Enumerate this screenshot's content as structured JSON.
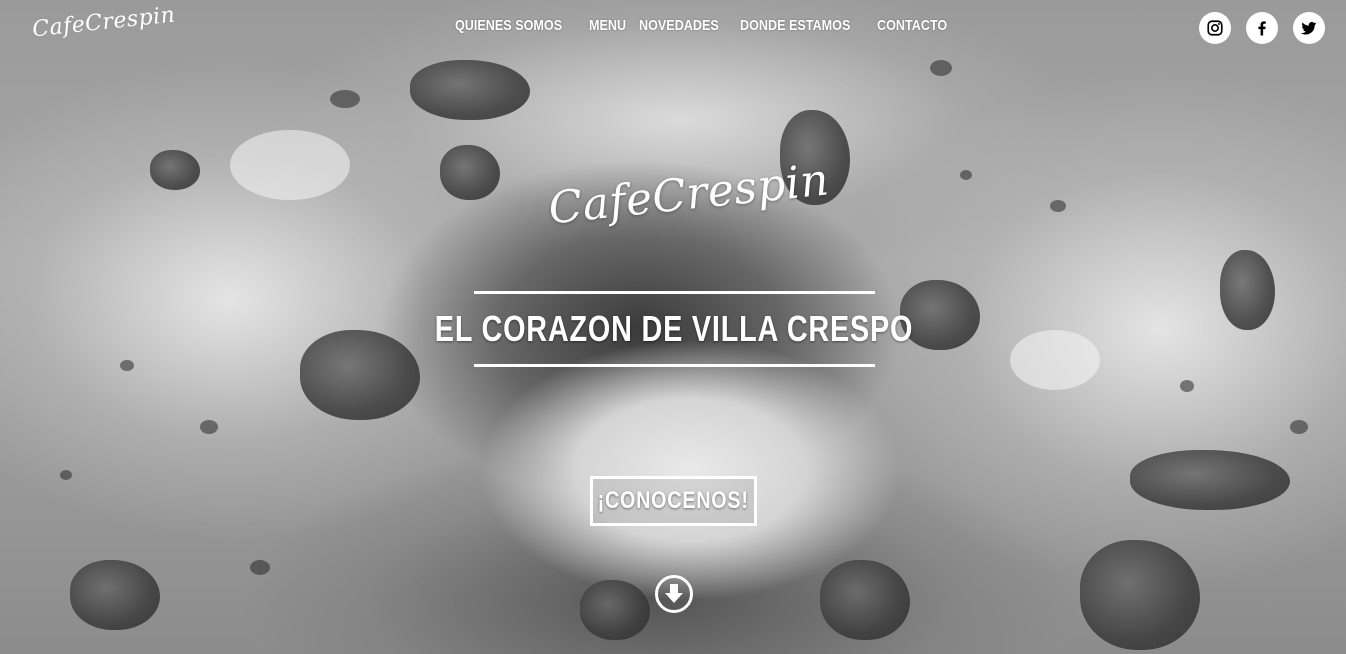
{
  "header": {
    "logo_text": "CafeCrespin",
    "nav": [
      {
        "label": "QUIENES SOMOS"
      },
      {
        "label": "MENU"
      },
      {
        "label": "NOVEDADES"
      },
      {
        "label": "DONDE ESTAMOS"
      },
      {
        "label": "CONTACTO"
      }
    ],
    "social": [
      {
        "icon": "instagram-icon"
      },
      {
        "icon": "facebook-icon"
      },
      {
        "icon": "twitter-icon"
      }
    ]
  },
  "hero": {
    "logo_text": "CafeCrespin",
    "tagline": "EL CORAZON DE VILLA CRESPO",
    "cta_label": "¡CONOCENOS!",
    "scroll_icon": "arrow-down-circle-icon"
  },
  "colors": {
    "text": "#ffffff",
    "background_tone": "grayscale"
  }
}
